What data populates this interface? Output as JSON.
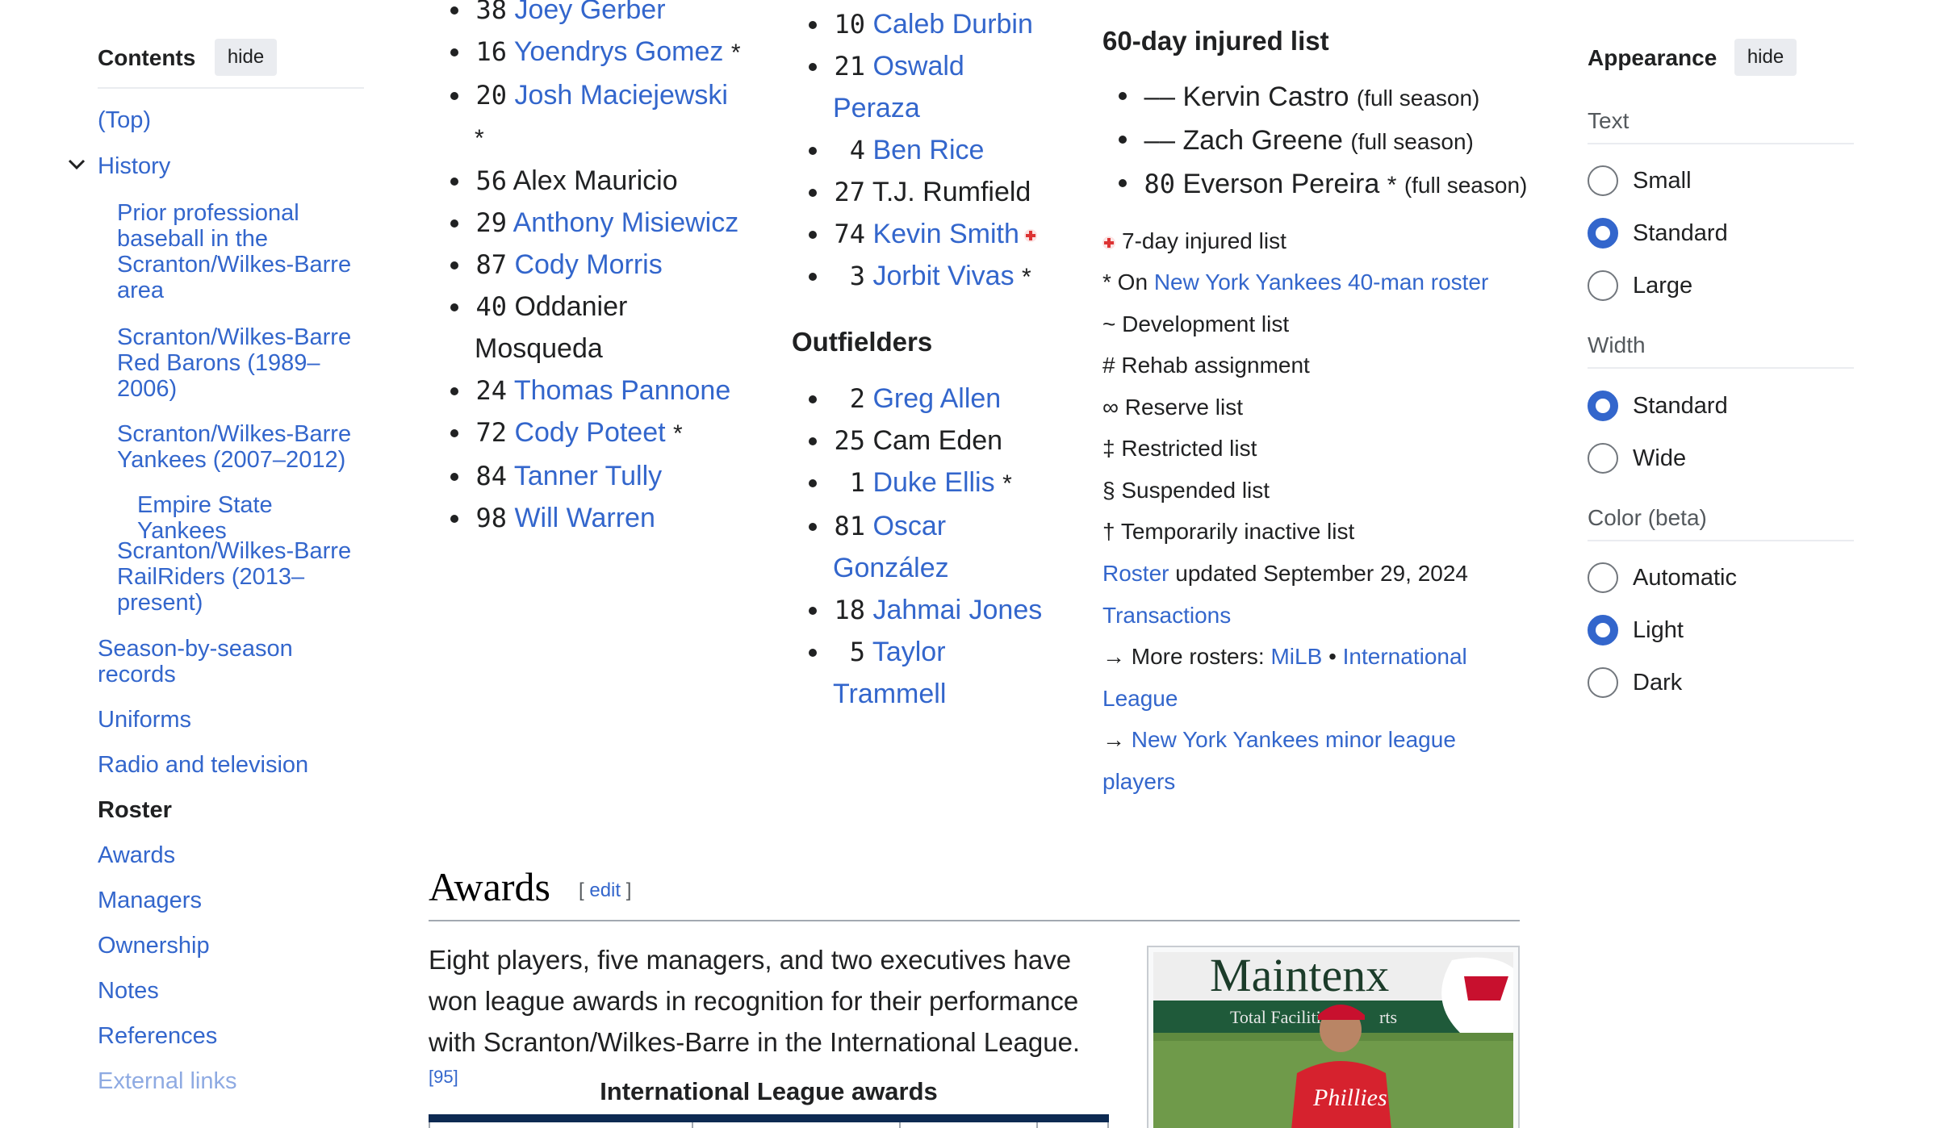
{
  "toc": {
    "title": "Contents",
    "hide_label": "hide",
    "items": [
      {
        "label": "(Top)"
      },
      {
        "label": "History"
      },
      {
        "label": "Prior professional baseball in the Scranton/Wilkes-Barre area"
      },
      {
        "label": "Scranton/Wilkes-Barre Red Barons (1989–2006)"
      },
      {
        "label": "Scranton/Wilkes-Barre Yankees (2007–2012)"
      },
      {
        "label": "Empire State Yankees"
      },
      {
        "label": "Scranton/Wilkes-Barre RailRiders (2013–present)"
      },
      {
        "label": "Season-by-season records"
      },
      {
        "label": "Uniforms"
      },
      {
        "label": "Radio and television"
      },
      {
        "label": "Roster"
      },
      {
        "label": "Awards"
      },
      {
        "label": "Managers"
      },
      {
        "label": "Ownership"
      },
      {
        "label": "Notes"
      },
      {
        "label": "References"
      },
      {
        "label": "External links"
      }
    ]
  },
  "pitchers": [
    {
      "num": "38",
      "name": "Joey Gerber",
      "link": true,
      "suffix": ""
    },
    {
      "num": "16",
      "name": "Yoendrys Gomez",
      "link": true,
      "suffix": "*"
    },
    {
      "num": "20",
      "name": "Josh Maciejewski",
      "link": true,
      "suffix": "*"
    },
    {
      "num": "56",
      "name": "Alex Mauricio",
      "link": false,
      "suffix": ""
    },
    {
      "num": "29",
      "name": "Anthony Misiewicz",
      "link": true,
      "suffix": ""
    },
    {
      "num": "87",
      "name": "Cody Morris",
      "link": true,
      "suffix": ""
    },
    {
      "num": "40",
      "name": "Oddanier",
      "name2": "Mosqueda",
      "link": false,
      "suffix": ""
    },
    {
      "num": "24",
      "name": "Thomas Pannone",
      "link": true,
      "suffix": ""
    },
    {
      "num": "72",
      "name": "Cody Poteet",
      "link": true,
      "suffix": "*"
    },
    {
      "num": "84",
      "name": "Tanner Tully",
      "link": true,
      "suffix": ""
    },
    {
      "num": "98",
      "name": "Will Warren",
      "link": true,
      "suffix": ""
    }
  ],
  "infielders": [
    {
      "num": "10",
      "name": "Caleb Durbin",
      "link": true,
      "suffix": ""
    },
    {
      "num": "21",
      "name": "Oswald",
      "name2": "Peraza",
      "link": true,
      "suffix": ""
    },
    {
      "num": "4",
      "name": "Ben Rice",
      "link": true,
      "suffix": ""
    },
    {
      "num": "27",
      "name": "T.J. Rumfield",
      "link": false,
      "suffix": ""
    },
    {
      "num": "74",
      "name": "Kevin Smith",
      "link": true,
      "suffix": "",
      "cross": true
    },
    {
      "num": "3",
      "name": "Jorbit Vivas",
      "link": true,
      "suffix": "*"
    }
  ],
  "outfielders_heading": "Outfielders",
  "outfielders": [
    {
      "num": "2",
      "name": "Greg Allen",
      "link": true,
      "suffix": ""
    },
    {
      "num": "25",
      "name": "Cam Eden",
      "link": false,
      "suffix": ""
    },
    {
      "num": "1",
      "name": "Duke Ellis",
      "link": true,
      "suffix": "*"
    },
    {
      "num": "81",
      "name": "Oscar",
      "name2": "González",
      "link": true,
      "suffix": ""
    },
    {
      "num": "18",
      "name": "Jahmai Jones",
      "link": true,
      "suffix": ""
    },
    {
      "num": "5",
      "name": "Taylor",
      "name2": "Trammell",
      "link": true,
      "suffix": ""
    }
  ],
  "injured": {
    "heading": "60-day injured list",
    "items": [
      {
        "num": "––",
        "name": "Kervin Castro",
        "suffix": "",
        "note": "(full season)"
      },
      {
        "num": "––",
        "name": "Zach Greene",
        "suffix": "",
        "note": "(full season)"
      },
      {
        "num": "80",
        "name": "Everson Pereira",
        "suffix": "*",
        "note": "(full season)"
      }
    ]
  },
  "legend": {
    "seven_day": "7-day injured list",
    "forty_man_prefix": "* On",
    "forty_man_link": "New York Yankees 40-man roster",
    "development": "~ Development list",
    "rehab": "# Rehab assignment",
    "reserve": "∞ Reserve list",
    "restricted": "‡ Restricted list",
    "suspended": "§ Suspended list",
    "temp_inactive": "† Temporarily inactive list",
    "roster_link": "Roster",
    "roster_updated": "updated September 29, 2024",
    "transactions": "Transactions",
    "more_rosters_prefix": "→ More rosters:",
    "milb": "MiLB",
    "bullet_sep": "•",
    "international": "International",
    "league": "League",
    "arrow": "→",
    "minor_league": "New York Yankees minor league",
    "players": "players"
  },
  "appearance": {
    "title": "Appearance",
    "hide_label": "hide",
    "text_label": "Text",
    "text_options": [
      "Small",
      "Standard",
      "Large"
    ],
    "text_selected": "Standard",
    "width_label": "Width",
    "width_options": [
      "Standard",
      "Wide"
    ],
    "width_selected": "Standard",
    "color_label": "Color (beta)",
    "color_options": [
      "Automatic",
      "Light",
      "Dark"
    ],
    "color_selected": "Light"
  },
  "awards": {
    "heading": "Awards",
    "edit_open": "[",
    "edit_label": "edit",
    "edit_close": "]",
    "paragraph": "Eight players, five managers, and two executives have won league awards in recognition for their performance with Scranton/Wilkes-Barre in the International League.",
    "citation": "[95]",
    "table_caption": "International League awards",
    "photo_text": "Maintenx",
    "photo_text2": "Total Facilities Re",
    "photo_text3": "rts",
    "jersey_text": "Phillies"
  },
  "colors": {
    "link": "#3366cc",
    "text": "#202122",
    "muted": "#54595d",
    "radio_selected": "#3366cc"
  }
}
